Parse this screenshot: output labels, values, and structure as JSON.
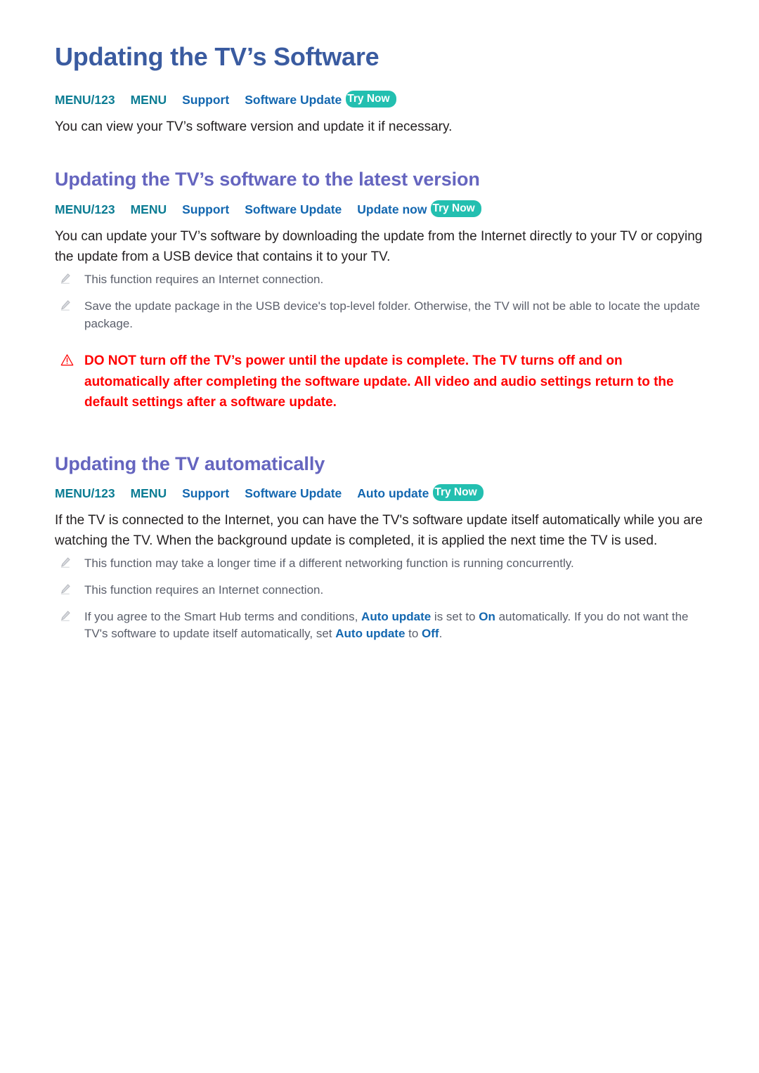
{
  "document": {
    "title": "Updating the TV’s Software"
  },
  "menu_paths": {
    "main": {
      "segments": [
        "MENU/123",
        "MENU",
        "Support",
        "Software Update"
      ],
      "badge": "Try Now"
    },
    "latest_version": {
      "segments": [
        "MENU/123",
        "MENU",
        "Support",
        "Software Update",
        "Update now"
      ],
      "badge": "Try Now"
    },
    "auto_update": {
      "segments": [
        "MENU/123",
        "MENU",
        "Support",
        "Software Update",
        "Auto update"
      ],
      "badge": "Try Now"
    }
  },
  "intro": {
    "paragraph": "You can view your TV’s software version and update it if necessary."
  },
  "sections": [
    {
      "heading": "Updating the TV’s software to the latest version",
      "paragraph": "You can update your TV’s software by downloading the update from the Internet directly to your TV or copying the update from a USB device that contains it to your TV.",
      "notes": [
        {
          "text": "This function requires an Internet connection."
        },
        {
          "text": "Save the update package in the USB device's top-level folder. Otherwise, the TV will not be able to locate the update package."
        }
      ],
      "warning": "DO NOT turn off the TV’s power until the update is complete. The TV turns off and on automatically after completing the software update. All video and audio settings return to the default settings after a software update."
    },
    {
      "heading": "Updating the TV automatically",
      "paragraph": "If the TV is connected to the Internet, you can have the TV's software update itself automatically while you are watching the TV. When the background update is completed, it is applied the next time the TV is used.",
      "notes": [
        {
          "text": "This function may take a longer time if a different networking function is running concurrently."
        },
        {
          "text": "This function requires an Internet connection."
        }
      ]
    }
  ],
  "auto_update_note": {
    "part1": "If you agree to the Smart Hub terms and conditions, ",
    "term1": "Auto update",
    "part2": " is set to ",
    "term2": "On",
    "part3": " automatically. If you do not want the TV's software to update itself automatically, set ",
    "term3": "Auto update",
    "part4": " to ",
    "term4": "Off",
    "part5": "."
  },
  "icons": {
    "note_marker": "pencil-icon",
    "warning_marker": "warning-triangle-icon",
    "badge": "try-now-badge"
  },
  "colors": {
    "title": "#3a5ba0",
    "section_heading": "#6565bf",
    "menu_teal": "#0b7c93",
    "menu_blue": "#1367b0",
    "badge_bg": "#23bfb0",
    "warning_red": "#ff0000",
    "note_gray": "#5b5f6b",
    "body_text": "#231f20"
  }
}
